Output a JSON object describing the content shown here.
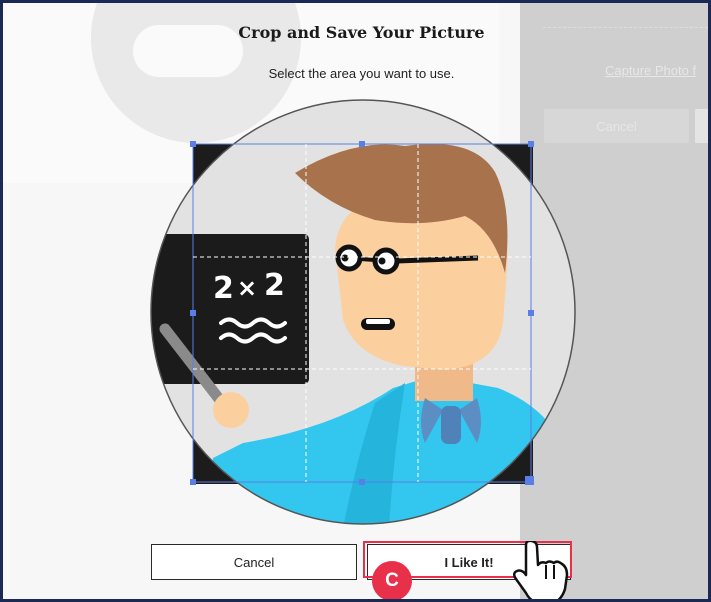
{
  "dialog": {
    "title": "Crop and Save Your Picture",
    "subtitle": "Select the area you want to use."
  },
  "board": {
    "equation_left": "2",
    "equation_op": "×",
    "equation_right": "2"
  },
  "buttons": {
    "cancel": "Cancel",
    "confirm": "I Like It!"
  },
  "background_panel": {
    "link_text": "Capture Photo f",
    "cancel_label": "Cancel"
  },
  "callout": {
    "badge_letter": "C"
  },
  "colors": {
    "highlight": "#e8304a",
    "frame_border": "#1b2a55",
    "crop_guide": "#5b7de6",
    "shirt": "#33c6ee",
    "skin": "#fccf9f",
    "hair": "#a8724c",
    "bow_tie": "#5b8fc4"
  }
}
